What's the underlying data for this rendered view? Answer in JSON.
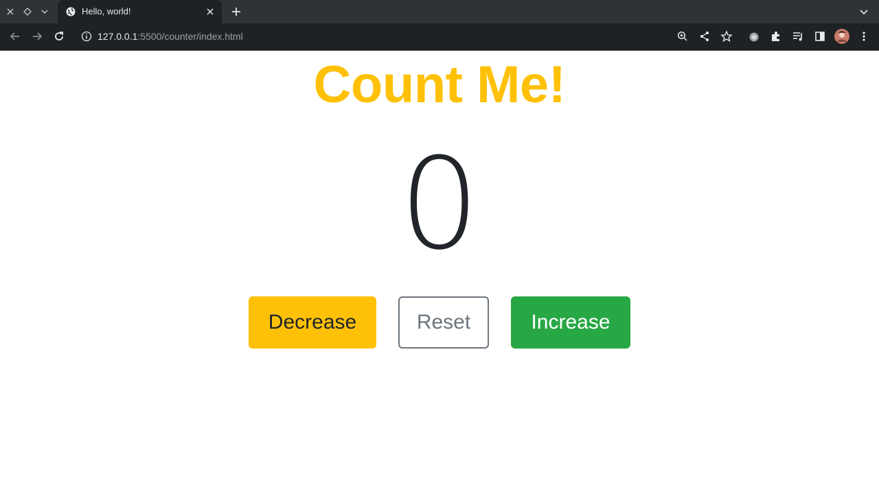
{
  "browser": {
    "tab": {
      "title": "Hello, world!"
    },
    "url": {
      "host": "127.0.0.1",
      "path": ":5500/counter/index.html"
    },
    "icons": [
      "close-icon",
      "diamond-icon",
      "chevron-down-icon",
      "globe-icon",
      "plus-icon",
      "back-icon",
      "forward-icon",
      "reload-icon",
      "info-icon",
      "zoom-icon",
      "share-icon",
      "star-icon",
      "extension-icon",
      "puzzle-icon",
      "media-icon",
      "sidepanel-icon",
      "avatar",
      "menu-icon"
    ]
  },
  "page": {
    "heading": "Count Me!",
    "counter_value": "0",
    "buttons": {
      "decrease": "Decrease",
      "reset": "Reset",
      "increase": "Increase"
    }
  },
  "colors": {
    "heading": "#ffc107",
    "decrease": "#ffc107",
    "reset_border": "#6c757d",
    "increase": "#28a745",
    "counter": "#212529"
  }
}
